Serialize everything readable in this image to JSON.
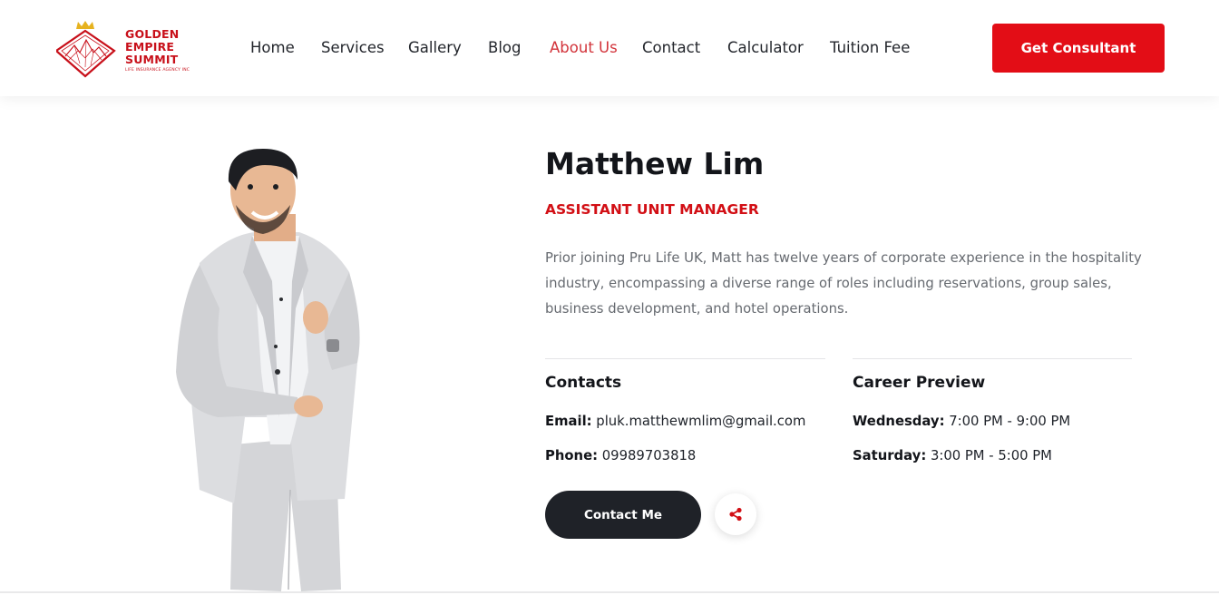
{
  "header": {
    "logo": {
      "line1": "GOLDEN",
      "line2": "EMPIRE",
      "line3": "SUMMIT",
      "subtitle": "LIFE INSURANCE AGENCY INC",
      "icon": "diamond-crown-logo"
    },
    "nav": [
      {
        "label": "Home",
        "active": false
      },
      {
        "label": "Services",
        "active": false
      },
      {
        "label": "Gallery",
        "active": false
      },
      {
        "label": "Blog",
        "active": false
      },
      {
        "label": "About Us",
        "active": true
      },
      {
        "label": "Contact",
        "active": false
      },
      {
        "label": "Calculator",
        "active": false
      },
      {
        "label": "Tuition Fee",
        "active": false
      }
    ],
    "cta_label": "Get Consultant"
  },
  "profile": {
    "name": "Matthew Lim",
    "role": "ASSISTANT UNIT MANAGER",
    "bio": "Prior joining Pru Life UK, Matt has twelve years of corporate experience in the hospitality industry, encompassing a diverse range of roles including reservations, group sales, business development, and hotel operations.",
    "contacts": {
      "title": "Contacts",
      "email_label": "Email:",
      "email": "pluk.matthewmlim@gmail.com",
      "phone_label": "Phone:",
      "phone": "09989703818"
    },
    "career": {
      "title": "Career Preview",
      "day1_label": "Wednesday:",
      "day1_time": "7:00 PM - 9:00 PM",
      "day2_label": "Saturday:",
      "day2_time": "3:00 PM - 5:00 PM"
    },
    "contact_button": "Contact Me",
    "share_icon": "share-icon"
  },
  "colors": {
    "brand_red": "#e30d16",
    "active_nav": "#d2333a",
    "dark_button": "#1f2228",
    "body_text": "#666a70"
  }
}
